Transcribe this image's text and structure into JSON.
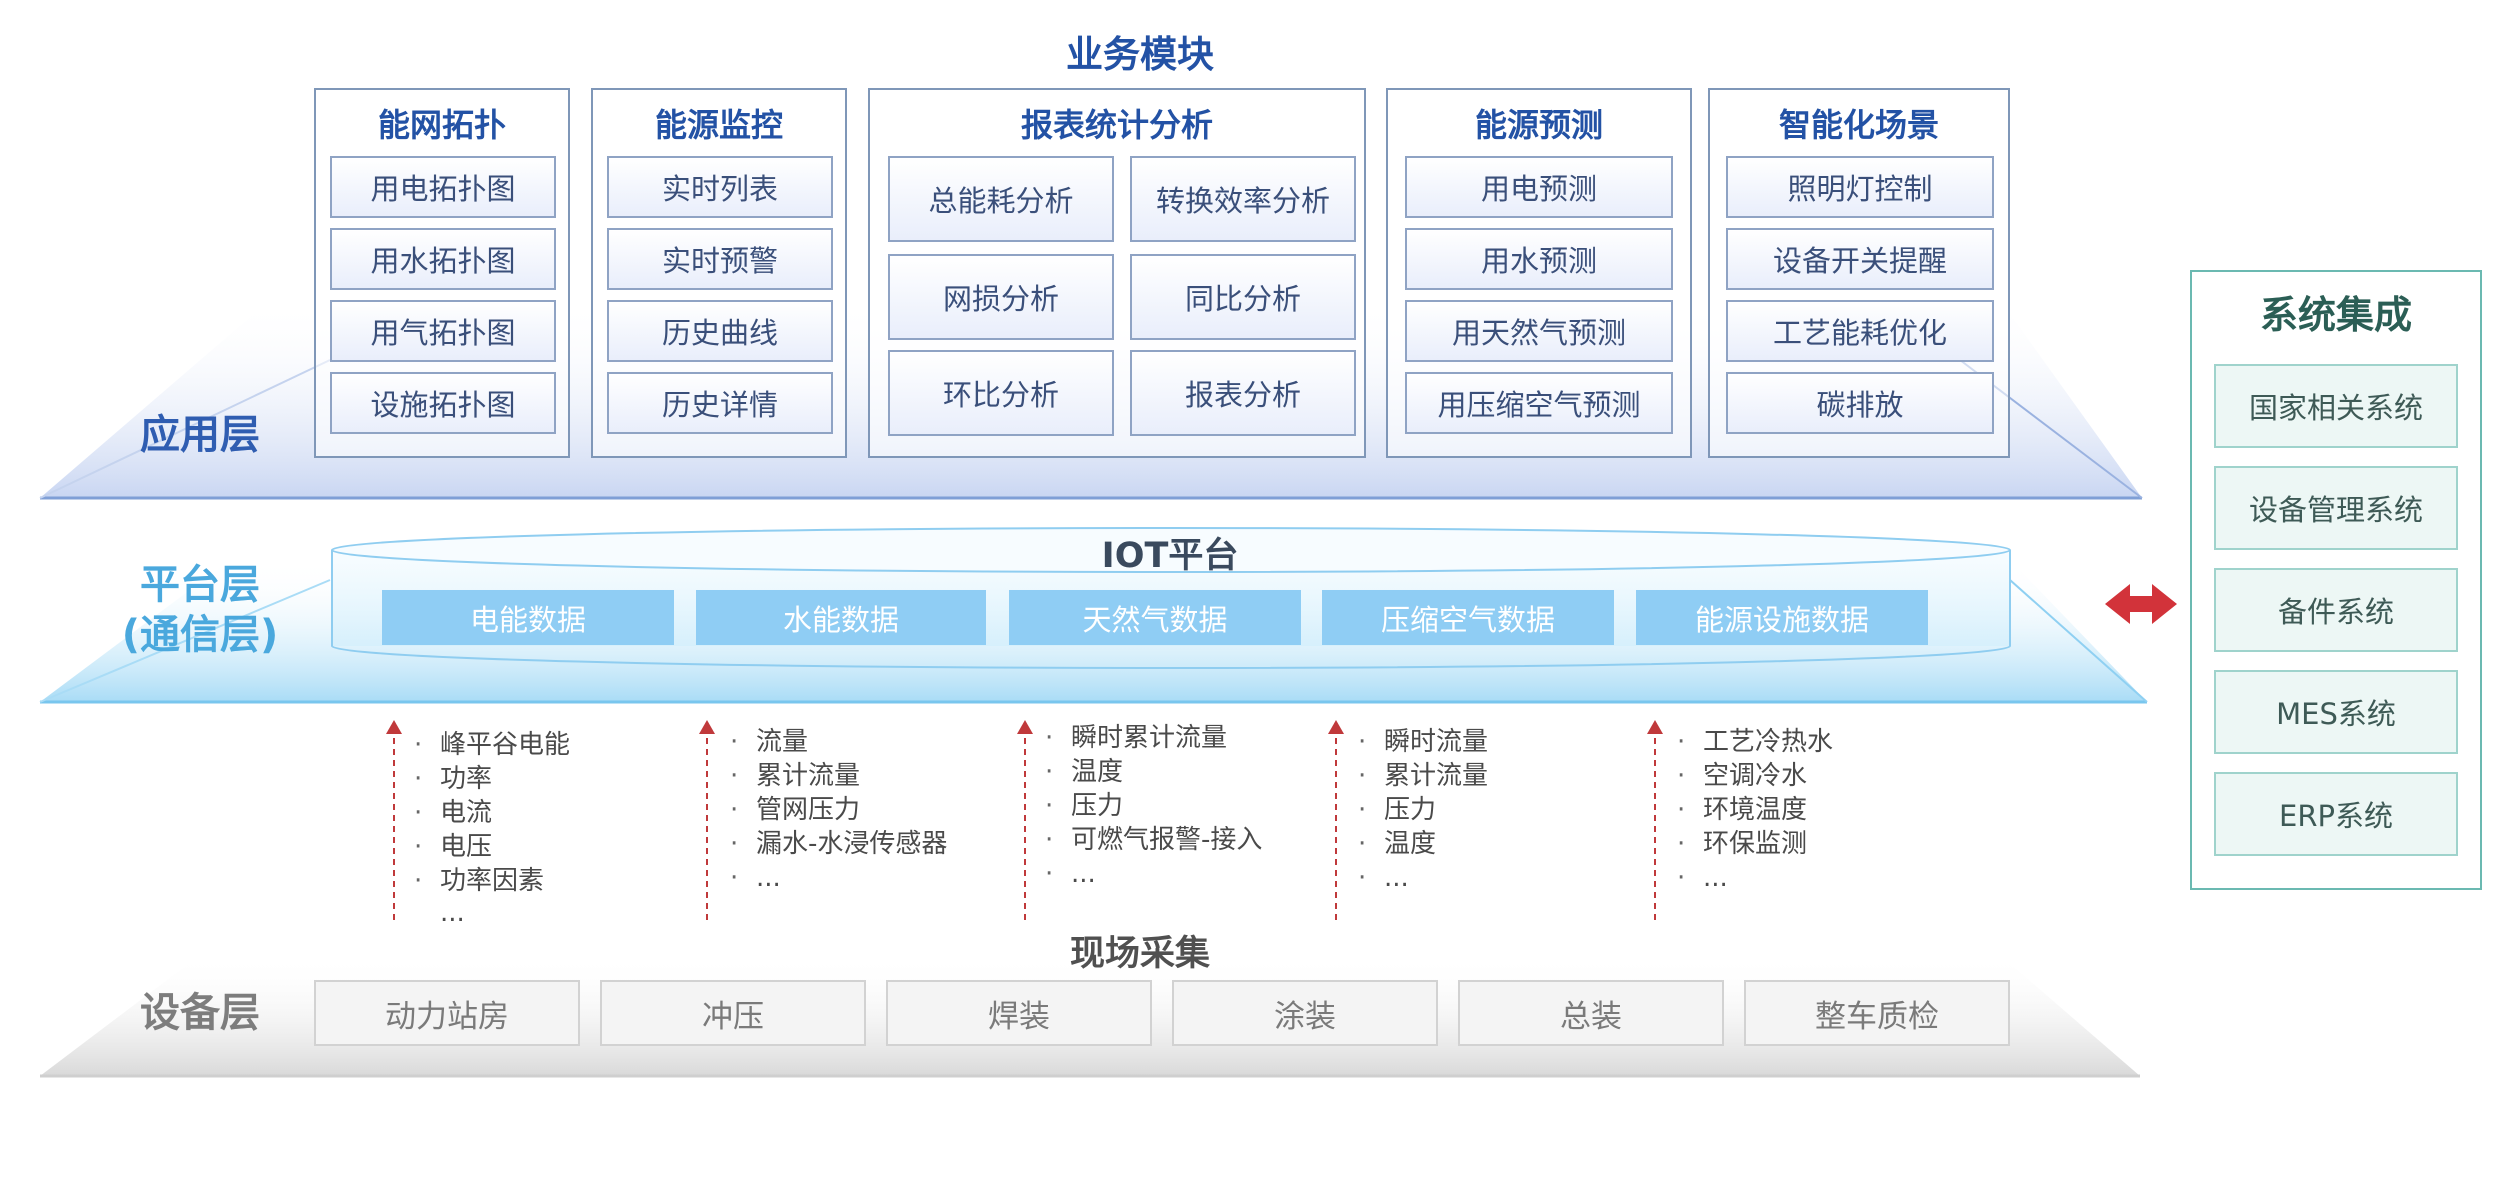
{
  "business_title": "业务模块",
  "layers": {
    "application": "应用层",
    "platform_line1": "平台层",
    "platform_line2": "(通信层)",
    "device": "设备层"
  },
  "modules": [
    {
      "title": "能网拓扑",
      "items": [
        "用电拓扑图",
        "用水拓扑图",
        "用气拓扑图",
        "设施拓扑图"
      ]
    },
    {
      "title": "能源监控",
      "items": [
        "实时列表",
        "实时预警",
        "历史曲线",
        "历史详情"
      ]
    },
    {
      "title": "报表统计分析",
      "items": [
        "总能耗分析",
        "转换效率分析",
        "网损分析",
        "同比分析",
        "环比分析",
        "报表分析"
      ]
    },
    {
      "title": "能源预测",
      "items": [
        "用电预测",
        "用水预测",
        "用天然气预测",
        "用压缩空气预测"
      ]
    },
    {
      "title": "智能化场景",
      "items": [
        "照明灯控制",
        "设备开关提醒",
        "工艺能耗优化",
        "碳排放"
      ]
    }
  ],
  "iot": {
    "title": "IOT平台",
    "chips": [
      "电能数据",
      "水能数据",
      "天然气数据",
      "压缩空气数据",
      "能源设施数据"
    ]
  },
  "collection": [
    {
      "items": [
        "峰平谷电能",
        "功率",
        "电流",
        "电压",
        "功率因素"
      ],
      "more": "..."
    },
    {
      "items": [
        "流量",
        "累计流量",
        "管网压力",
        "漏水-水浸传感器",
        "..."
      ],
      "more": ""
    },
    {
      "items": [
        "瞬时累计流量",
        "温度",
        "压力",
        "可燃气报警-接入",
        "..."
      ],
      "more": ""
    },
    {
      "items": [
        "瞬时流量",
        "累计流量",
        "压力",
        "温度",
        "..."
      ],
      "more": ""
    },
    {
      "items": [
        "工艺冷热水",
        "空调冷水",
        "环境温度",
        "环保监测",
        "..."
      ],
      "more": ""
    }
  ],
  "field_title": "现场采集",
  "devices": [
    "动力站房",
    "冲压",
    "焊装",
    "涂装",
    "总装",
    "整车质检"
  ],
  "system_integration": {
    "title": "系统集成",
    "items": [
      "国家相关系统",
      "设备管理系统",
      "备件系统",
      "MES系统",
      "ERP系统"
    ]
  },
  "colors": {
    "module_title": "#2352a5",
    "platform_chip": "#8fcdf4",
    "arrow": "#c0393b",
    "system_border": "#6bb9b1"
  }
}
